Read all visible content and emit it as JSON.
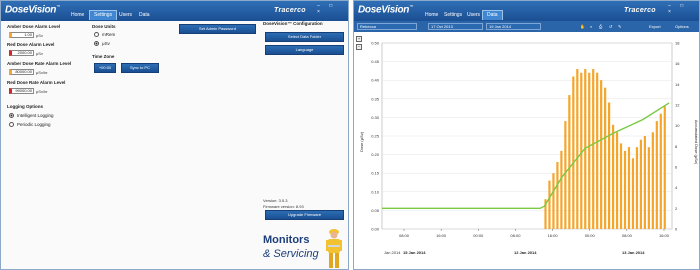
{
  "app": {
    "logo": "DoseVision",
    "tm": "™",
    "brand": "Tracerco",
    "window_controls": "– □ ×"
  },
  "left": {
    "tabs": [
      "Home",
      "Settings",
      "Users",
      "Data"
    ],
    "active_tab": "Settings",
    "amber_alarm": {
      "label": "Amber Dose Alarm Level",
      "value": "1.00",
      "unit": "μSv"
    },
    "red_alarm": {
      "label": "Red Dose Alarm Level",
      "value": "2000.00",
      "unit": "μSv"
    },
    "amber_rate": {
      "label": "Amber Dose Rate Alarm Level",
      "value": "80000.00",
      "unit": "μSv/hr"
    },
    "red_rate": {
      "label": "Red Dose Rate Alarm Level",
      "value": "99000.00",
      "unit": "μSv/hr"
    },
    "logging": {
      "title": "Logging Options",
      "options": [
        "Intelligent Logging",
        "Periodic Logging"
      ],
      "selected": 0
    },
    "dose_units": {
      "title": "Dose Units",
      "options": [
        "mRem",
        "μSv"
      ],
      "selected": 1
    },
    "time_zone": {
      "title": "Time Zone",
      "value": "+00:00",
      "sync_label": "Sync to PC"
    },
    "admin_button": "Set Admin Password",
    "config": {
      "title": "DoseVision™ Configuration",
      "select_folder": "Select Data Folder",
      "language": "Language"
    },
    "version": "Version: 3.5.3",
    "firmware": "Firmware version: 8.93",
    "upgrade_button": "Upgrade Firmware",
    "banner": {
      "line1": "Monitors",
      "line2": "& Servicing"
    }
  },
  "right": {
    "tabs": [
      "Home",
      "Settings",
      "Users",
      "Data"
    ],
    "active_tab": "Data",
    "toolbar": {
      "person": "Rebecca",
      "start_date": "17 Oct 2013",
      "end_date": "19 Jan 2014",
      "export": "Export",
      "options": "Options",
      "tool_icons": [
        "hand-icon",
        "zoom-icon",
        "print-icon",
        "undo-icon",
        "pen-icon"
      ]
    },
    "chart_data": {
      "type": "bar+line",
      "ylabel": "Dose (μSv)",
      "y2label": "Accumulated Dose (μSv)",
      "ylim": [
        0,
        0.5
      ],
      "y2lim": [
        0,
        18
      ],
      "yticks": [
        "0.00",
        "0.05",
        "0.10",
        "0.15",
        "0.20",
        "0.25",
        "0.30",
        "0.35",
        "0.40",
        "0.45",
        "0.50"
      ],
      "y2ticks": [
        "0",
        "2",
        "4",
        "6",
        "8",
        "10",
        "12",
        "14",
        "16",
        "18"
      ],
      "xticks": [
        "08:00",
        "16:00",
        "00:00",
        "08:00",
        "16:00",
        "00:00",
        "08:00",
        "16:00"
      ],
      "date_labels": [
        "15 Jan 2014",
        "12 Jan 2014",
        "13 Jan 2014"
      ],
      "partial_label": "Jan 2014",
      "bars": [
        0.08,
        0.13,
        0.15,
        0.18,
        0.21,
        0.29,
        0.36,
        0.41,
        0.43,
        0.42,
        0.43,
        0.42,
        0.43,
        0.42,
        0.4,
        0.38,
        0.34,
        0.28,
        0.26,
        0.23,
        0.21,
        0.22,
        0.19,
        0.22,
        0.24,
        0.25,
        0.22,
        0.26,
        0.29,
        0.31,
        0.33
      ],
      "bars_x_start": 0.56,
      "bars_x_end": 0.985,
      "line": [
        [
          0,
          2.0
        ],
        [
          0.545,
          2.0
        ],
        [
          0.56,
          2.2
        ],
        [
          0.62,
          5.0
        ],
        [
          0.7,
          7.8
        ],
        [
          0.8,
          9.3
        ],
        [
          0.9,
          10.6
        ],
        [
          0.99,
          12.2
        ]
      ],
      "bar_color": "#f4a52a",
      "line_color": "#7ac943"
    }
  }
}
